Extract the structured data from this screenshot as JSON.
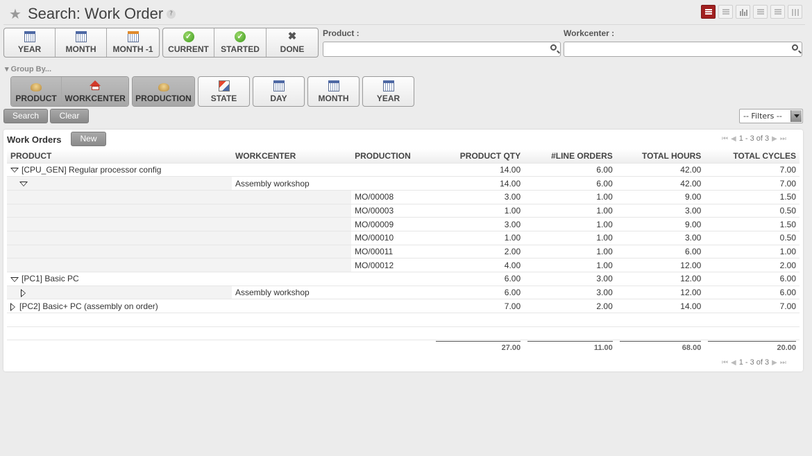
{
  "header": {
    "title": "Search: Work Order",
    "help": "?"
  },
  "filters": {
    "date_buttons": [
      "YEAR",
      "MONTH",
      "MONTH -1"
    ],
    "state_buttons": [
      "CURRENT",
      "STARTED",
      "DONE"
    ],
    "product_label": "Product :",
    "product_value": "",
    "workcenter_label": "Workcenter :",
    "workcenter_value": ""
  },
  "group_by": {
    "label": "▾ Group By...",
    "buttons": [
      "PRODUCT",
      "WORKCENTER",
      "PRODUCTION",
      "STATE",
      "DAY",
      "MONTH",
      "YEAR"
    ],
    "active": [
      "PRODUCT",
      "WORKCENTER",
      "PRODUCTION"
    ]
  },
  "actions": {
    "search": "Search",
    "clear": "Clear",
    "filters_select": "-- Filters --"
  },
  "list": {
    "title": "Work Orders",
    "new_label": "New",
    "pager": "1 - 3 of 3",
    "columns": [
      "PRODUCT",
      "WORKCENTER",
      "PRODUCTION",
      "PRODUCT QTY",
      "#LINE ORDERS",
      "TOTAL HOURS",
      "TOTAL CYCLES"
    ],
    "rows": [
      {
        "product": "[CPU_GEN] Regular processor config",
        "workcenter": "",
        "production": "",
        "qty": "14.00",
        "lines": "6.00",
        "hours": "42.00",
        "cycles": "7.00"
      },
      {
        "product": "",
        "workcenter": "Assembly workshop",
        "production": "",
        "qty": "14.00",
        "lines": "6.00",
        "hours": "42.00",
        "cycles": "7.00"
      },
      {
        "product": "",
        "workcenter": "",
        "production": "MO/00008",
        "qty": "3.00",
        "lines": "1.00",
        "hours": "9.00",
        "cycles": "1.50"
      },
      {
        "product": "",
        "workcenter": "",
        "production": "MO/00003",
        "qty": "1.00",
        "lines": "1.00",
        "hours": "3.00",
        "cycles": "0.50"
      },
      {
        "product": "",
        "workcenter": "",
        "production": "MO/00009",
        "qty": "3.00",
        "lines": "1.00",
        "hours": "9.00",
        "cycles": "1.50"
      },
      {
        "product": "",
        "workcenter": "",
        "production": "MO/00010",
        "qty": "1.00",
        "lines": "1.00",
        "hours": "3.00",
        "cycles": "0.50"
      },
      {
        "product": "",
        "workcenter": "",
        "production": "MO/00011",
        "qty": "2.00",
        "lines": "1.00",
        "hours": "6.00",
        "cycles": "1.00"
      },
      {
        "product": "",
        "workcenter": "",
        "production": "MO/00012",
        "qty": "4.00",
        "lines": "1.00",
        "hours": "12.00",
        "cycles": "2.00"
      },
      {
        "product": "[PC1] Basic PC",
        "workcenter": "",
        "production": "",
        "qty": "6.00",
        "lines": "3.00",
        "hours": "12.00",
        "cycles": "6.00"
      },
      {
        "product": "",
        "workcenter": "Assembly workshop",
        "production": "",
        "qty": "6.00",
        "lines": "3.00",
        "hours": "12.00",
        "cycles": "6.00"
      },
      {
        "product": "[PC2] Basic+ PC (assembly on order)",
        "workcenter": "",
        "production": "",
        "qty": "7.00",
        "lines": "2.00",
        "hours": "14.00",
        "cycles": "7.00"
      }
    ],
    "totals": {
      "qty": "27.00",
      "lines": "11.00",
      "hours": "68.00",
      "cycles": "20.00"
    }
  }
}
